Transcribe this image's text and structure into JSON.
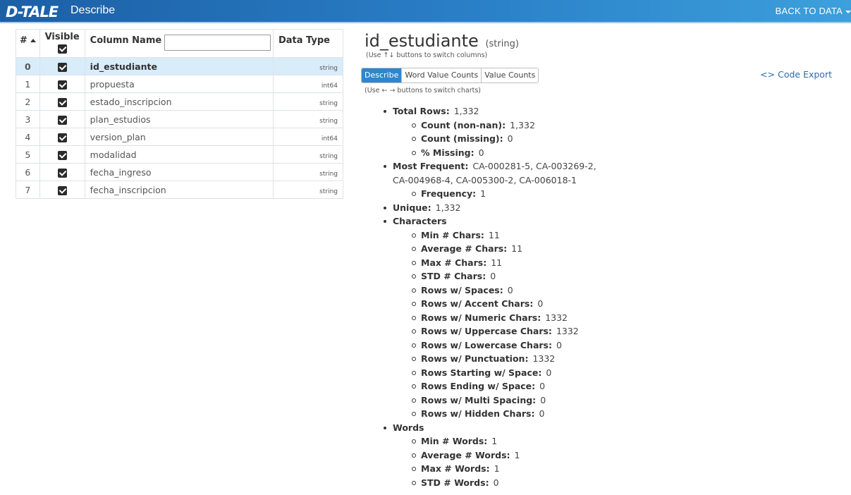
{
  "header": {
    "logo_text": "D-TALE",
    "title": "Describe",
    "back_label": "BACK TO DATA"
  },
  "table": {
    "headers": {
      "index": "#",
      "visible": "Visible",
      "name": "Column Name",
      "dtype": "Data Type"
    },
    "rows": [
      {
        "index": "0",
        "name": "id_estudiante",
        "dtype": "string",
        "visible": true,
        "selected": true
      },
      {
        "index": "1",
        "name": "propuesta",
        "dtype": "int64",
        "visible": true
      },
      {
        "index": "2",
        "name": "estado_inscripcion",
        "dtype": "string",
        "visible": true
      },
      {
        "index": "3",
        "name": "plan_estudios",
        "dtype": "string",
        "visible": true
      },
      {
        "index": "4",
        "name": "version_plan",
        "dtype": "int64",
        "visible": true
      },
      {
        "index": "5",
        "name": "modalidad",
        "dtype": "string",
        "visible": true
      },
      {
        "index": "6",
        "name": "fecha_ingreso",
        "dtype": "string",
        "visible": true
      },
      {
        "index": "7",
        "name": "fecha_inscripcion",
        "dtype": "string",
        "visible": true
      }
    ]
  },
  "detail": {
    "column_name": "id_estudiante",
    "column_type": "(string)",
    "hint_columns": "(Use ↑↓ buttons to switch columns)",
    "hint_charts": "(Use ← → buttons to switch charts)",
    "tabs": [
      "Describe",
      "Word Value Counts",
      "Value Counts"
    ],
    "active_tab": "Describe",
    "code_export": "Code Export"
  },
  "stats": {
    "total_rows": {
      "label": "Total Rows:",
      "value": "1,332"
    },
    "count_non_nan": {
      "label": "Count (non-nan):",
      "value": "1,332"
    },
    "count_missing": {
      "label": "Count (missing):",
      "value": "0"
    },
    "pct_missing": {
      "label": "% Missing:",
      "value": "0"
    },
    "most_frequent": {
      "label": "Most Frequent:",
      "value_line1": "CA-000281-5, CA-003269-2,",
      "value_line2": "CA-004968-4, CA-005300-2, CA-006018-1"
    },
    "frequency": {
      "label": "Frequency:",
      "value": "1"
    },
    "unique": {
      "label": "Unique:",
      "value": "1,332"
    },
    "characters_label": "Characters",
    "characters": [
      {
        "label": "Min # Chars:",
        "value": "11"
      },
      {
        "label": "Average # Chars:",
        "value": "11"
      },
      {
        "label": "Max # Chars:",
        "value": "11"
      },
      {
        "label": "STD # Chars:",
        "value": "0"
      },
      {
        "label": "Rows w/ Spaces:",
        "value": "0"
      },
      {
        "label": "Rows w/ Accent Chars:",
        "value": "0"
      },
      {
        "label": "Rows w/ Numeric Chars:",
        "value": "1332"
      },
      {
        "label": "Rows w/ Uppercase Chars:",
        "value": "1332"
      },
      {
        "label": "Rows w/ Lowercase Chars:",
        "value": "0"
      },
      {
        "label": "Rows w/ Punctuation:",
        "value": "1332"
      },
      {
        "label": "Rows Starting w/ Space:",
        "value": "0"
      },
      {
        "label": "Rows Ending w/ Space:",
        "value": "0"
      },
      {
        "label": "Rows w/ Multi Spacing:",
        "value": "0"
      },
      {
        "label": "Rows w/ Hidden Chars:",
        "value": "0"
      }
    ],
    "words_label": "Words",
    "words": [
      {
        "label": "Min # Words:",
        "value": "1"
      },
      {
        "label": "Average # Words:",
        "value": "1"
      },
      {
        "label": "Max # Words:",
        "value": "1"
      },
      {
        "label": "STD # Words:",
        "value": "0"
      }
    ]
  }
}
